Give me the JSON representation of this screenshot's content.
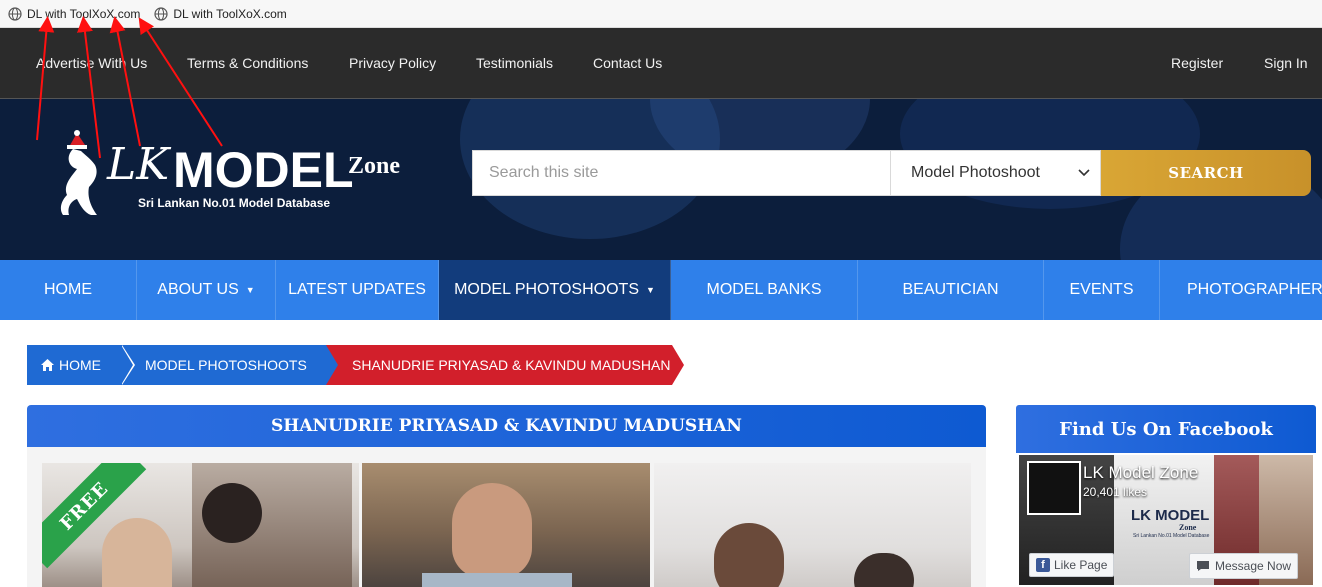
{
  "bookmarks": [
    {
      "label": "DL with ToolXoX.com",
      "icon": "globe-icon"
    },
    {
      "label": "DL with ToolXoX.com",
      "icon": "globe-icon"
    }
  ],
  "topnav": {
    "links": [
      "Advertise With Us",
      "Terms & Conditions",
      "Privacy Policy",
      "Testimonials",
      "Contact Us"
    ],
    "register": "Register",
    "sign_in": "Sign In"
  },
  "logo": {
    "lk": "LK",
    "model": "MODEL",
    "zone": "Zone",
    "tagline": "Sri Lankan No.01 Model Database"
  },
  "search": {
    "placeholder": "Search this site",
    "category": "Model Photoshoot",
    "button": "SEARCH"
  },
  "mainnav": {
    "items": [
      {
        "label": "HOME",
        "caret": false
      },
      {
        "label": "ABOUT US",
        "caret": true
      },
      {
        "label": "LATEST UPDATES",
        "caret": false
      },
      {
        "label": "MODEL PHOTOSHOOTS",
        "caret": true
      },
      {
        "label": "MODEL BANKS",
        "caret": false
      },
      {
        "label": "BEAUTICIAN",
        "caret": false
      },
      {
        "label": "EVENTS",
        "caret": false
      },
      {
        "label": "PHOTOGRAPHERS",
        "caret": false
      }
    ],
    "active_index": 3
  },
  "breadcrumb": {
    "home": "HOME",
    "section": "MODEL PHOTOSHOOTS",
    "current": "SHANUDRIE PRIYASAD & KAVINDU MADUSHAN"
  },
  "article": {
    "title": "SHANUDRIE PRIYASAD & KAVINDU MADUSHAN",
    "ribbon": "FREE"
  },
  "facebook": {
    "title": "Find Us On Facebook",
    "page_name": "LK Model Zone",
    "likes": "20,401 likes",
    "like_button": "Like Page",
    "message_button": "Message Now",
    "mini_logo": "LK MODEL",
    "mini_zone": "Zone",
    "mini_tagline": "Sri Lankan No.01 Model Database"
  },
  "colors": {
    "topnav_bg": "#2b2b2b",
    "header_bg": "#0c1e3c",
    "mainnav_bg": "#2f80ea",
    "mainnav_active": "#123c7c",
    "search_button": "#d9a635",
    "breadcrumb_blue": "#1f6ad3",
    "breadcrumb_red": "#d21f2b",
    "ribbon_green": "#2aa24a"
  }
}
